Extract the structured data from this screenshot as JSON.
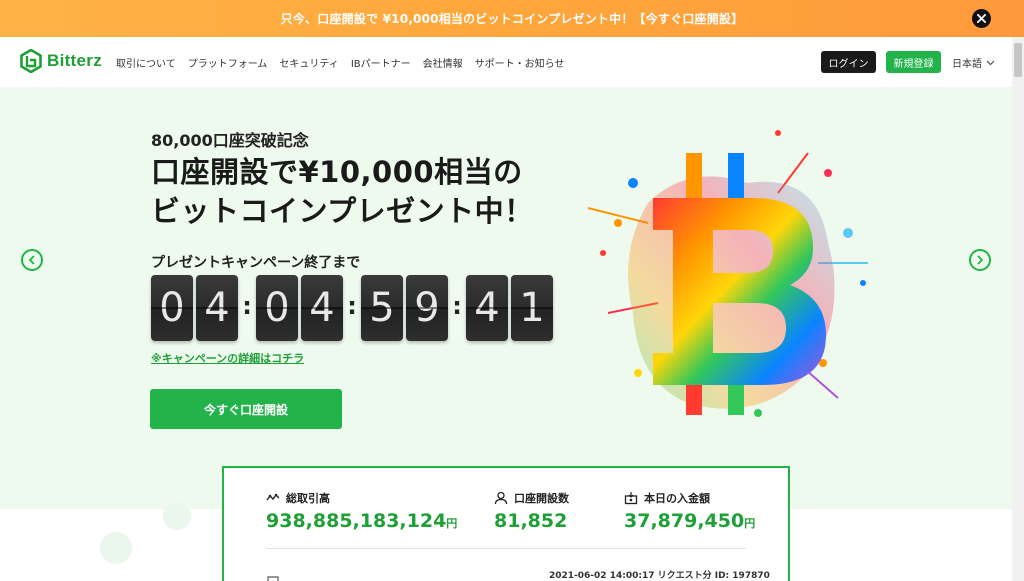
{
  "promo": {
    "text": "只今、口座開設で ¥10,000相当のビットコインプレゼント中！【今すぐ口座開設】"
  },
  "header": {
    "logo_text": "Bitterz",
    "nav": [
      "取引について",
      "プラットフォーム",
      "セキュリティ",
      "IBパートナー",
      "会社情報",
      "サポート・お知らせ"
    ],
    "login_label": "ログイン",
    "register_label": "新規登録",
    "language": "日本語"
  },
  "hero": {
    "subtitle": "80,000口座突破記念",
    "title_line1": "口座開設で¥10,000相当の",
    "title_line2": "ビットコインプレゼント中！",
    "countdown_label": "プレゼントキャンペーン終了まで",
    "countdown_digits": [
      "0",
      "4",
      "0",
      "4",
      "5",
      "9",
      "4",
      "1"
    ],
    "campaign_link": "※キャンペーンの詳細はコチラ",
    "cta_label": "今すぐ口座開設"
  },
  "stats": {
    "items": [
      {
        "label": "総取引高",
        "value": "938,885,183,124",
        "unit": "円",
        "icon": "chart-line-icon"
      },
      {
        "label": "口座開設数",
        "value": "81,852",
        "unit": "",
        "icon": "user-icon"
      },
      {
        "label": "本日の入金額",
        "value": "37,879,450",
        "unit": "円",
        "icon": "deposit-icon"
      }
    ],
    "timestamp": "2021-06-02 14:00:17 リクエスト分 ID: 197870"
  },
  "colors": {
    "brand_green": "#22b34a",
    "promo_orange": "#ffa63b",
    "hero_bg": "#eefaee"
  }
}
